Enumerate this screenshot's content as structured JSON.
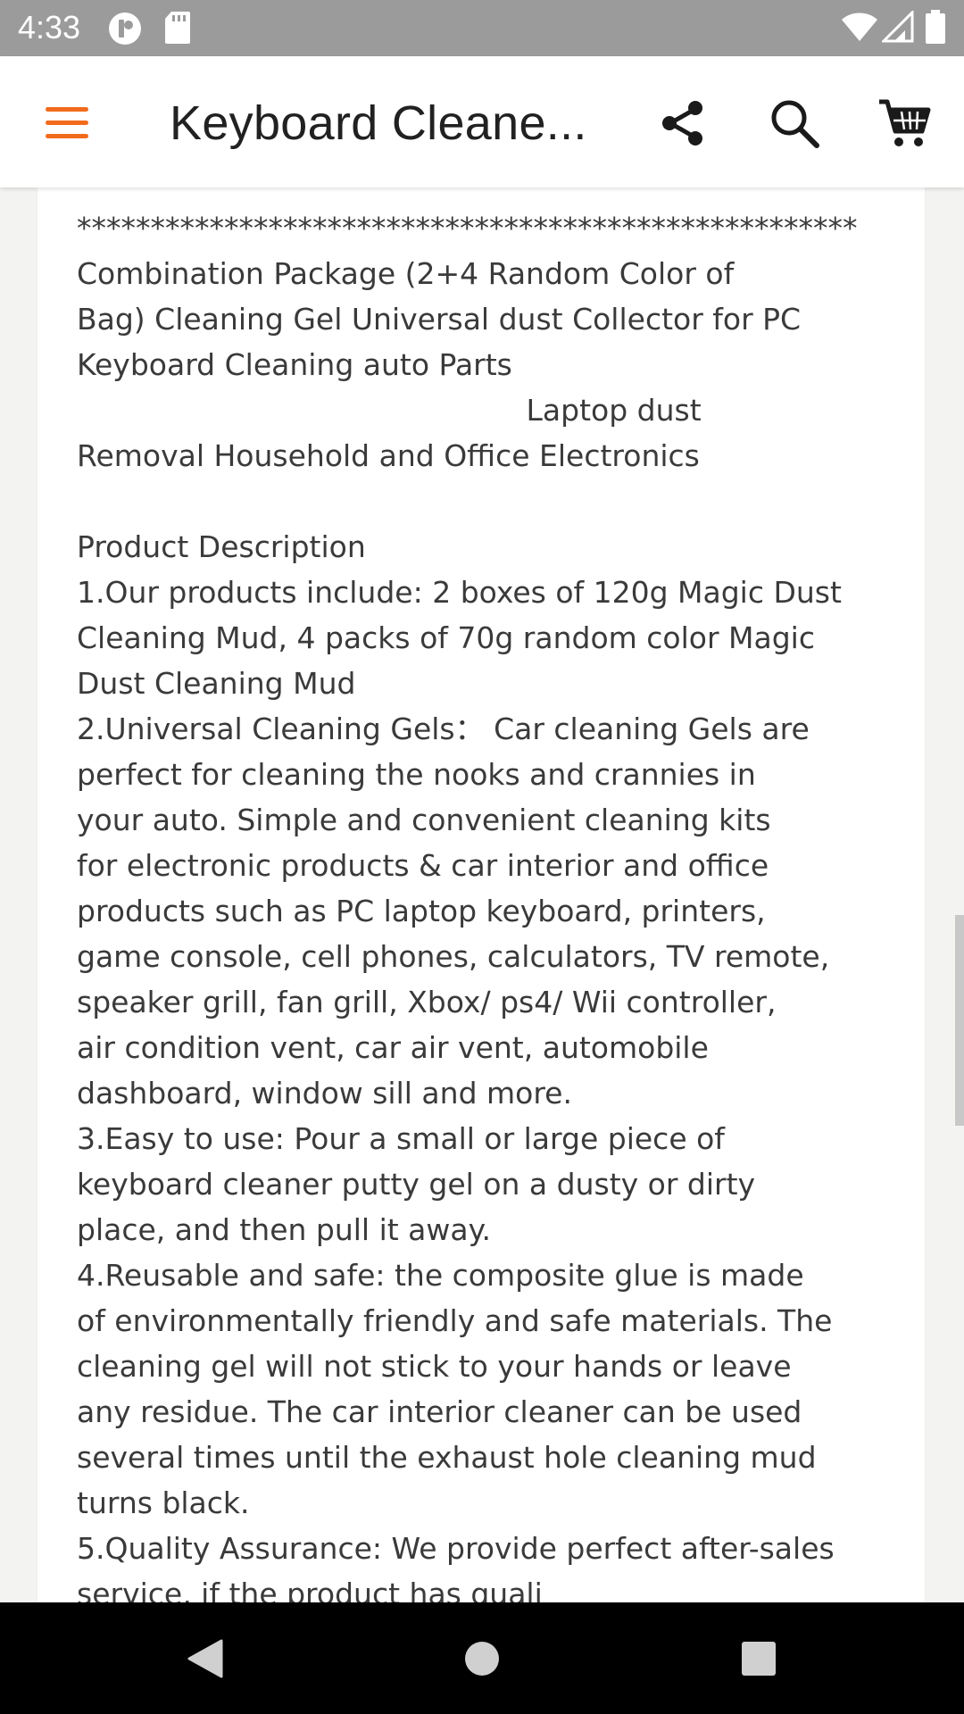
{
  "status_bar": {
    "time": "4:33",
    "icons": [
      "notification-app-icon",
      "sd-card-icon",
      "wifi-icon",
      "signal-icon",
      "battery-icon"
    ]
  },
  "app_bar": {
    "title": "Keyboard Cleane...",
    "accent_color": "#f26b1d",
    "icons": [
      "menu-icon",
      "share-icon",
      "search-icon",
      "cart-icon"
    ]
  },
  "description": {
    "separator": "*****************************************************",
    "lines": [
      "Combination Package (2+4 Random Color of",
      "Bag) Cleaning Gel Universal dust Collector for PC",
      "Keyboard Cleaning auto Parts",
      "                                                Laptop dust",
      "Removal Household and Office Electronics",
      "",
      "Product Description",
      "1.Our products include: 2 boxes of 120g Magic Dust",
      "Cleaning Mud, 4 packs of 70g random color Magic",
      "Dust Cleaning Mud",
      "2.Universal Cleaning Gels： Car cleaning Gels are",
      "perfect for cleaning the nooks and crannies in",
      "your auto. Simple and convenient cleaning kits",
      "for electronic products & car interior and office",
      "products such as PC laptop keyboard, printers,",
      "game console, cell phones, calculators, TV remote,",
      "speaker grill, fan grill, Xbox/ ps4/ Wii controller,",
      "air condition vent, car air vent, automobile",
      "dashboard, window sill and more.",
      "3.Easy to use: Pour a small or large piece of",
      "keyboard cleaner putty gel on a dusty or dirty",
      "place, and then pull it away.",
      "4.Reusable and safe: the composite glue is made",
      "of environmentally friendly and safe materials. The",
      "cleaning gel will not stick to your hands or leave",
      "any residue. The car interior cleaner can be used",
      "several times until the exhaust hole cleaning mud",
      "turns black.",
      "5.Quality Assurance: We provide perfect after-sales",
      "service, if the product has quali"
    ]
  },
  "nav_bar": {
    "icons": [
      "back-icon",
      "home-icon",
      "recents-icon"
    ]
  }
}
